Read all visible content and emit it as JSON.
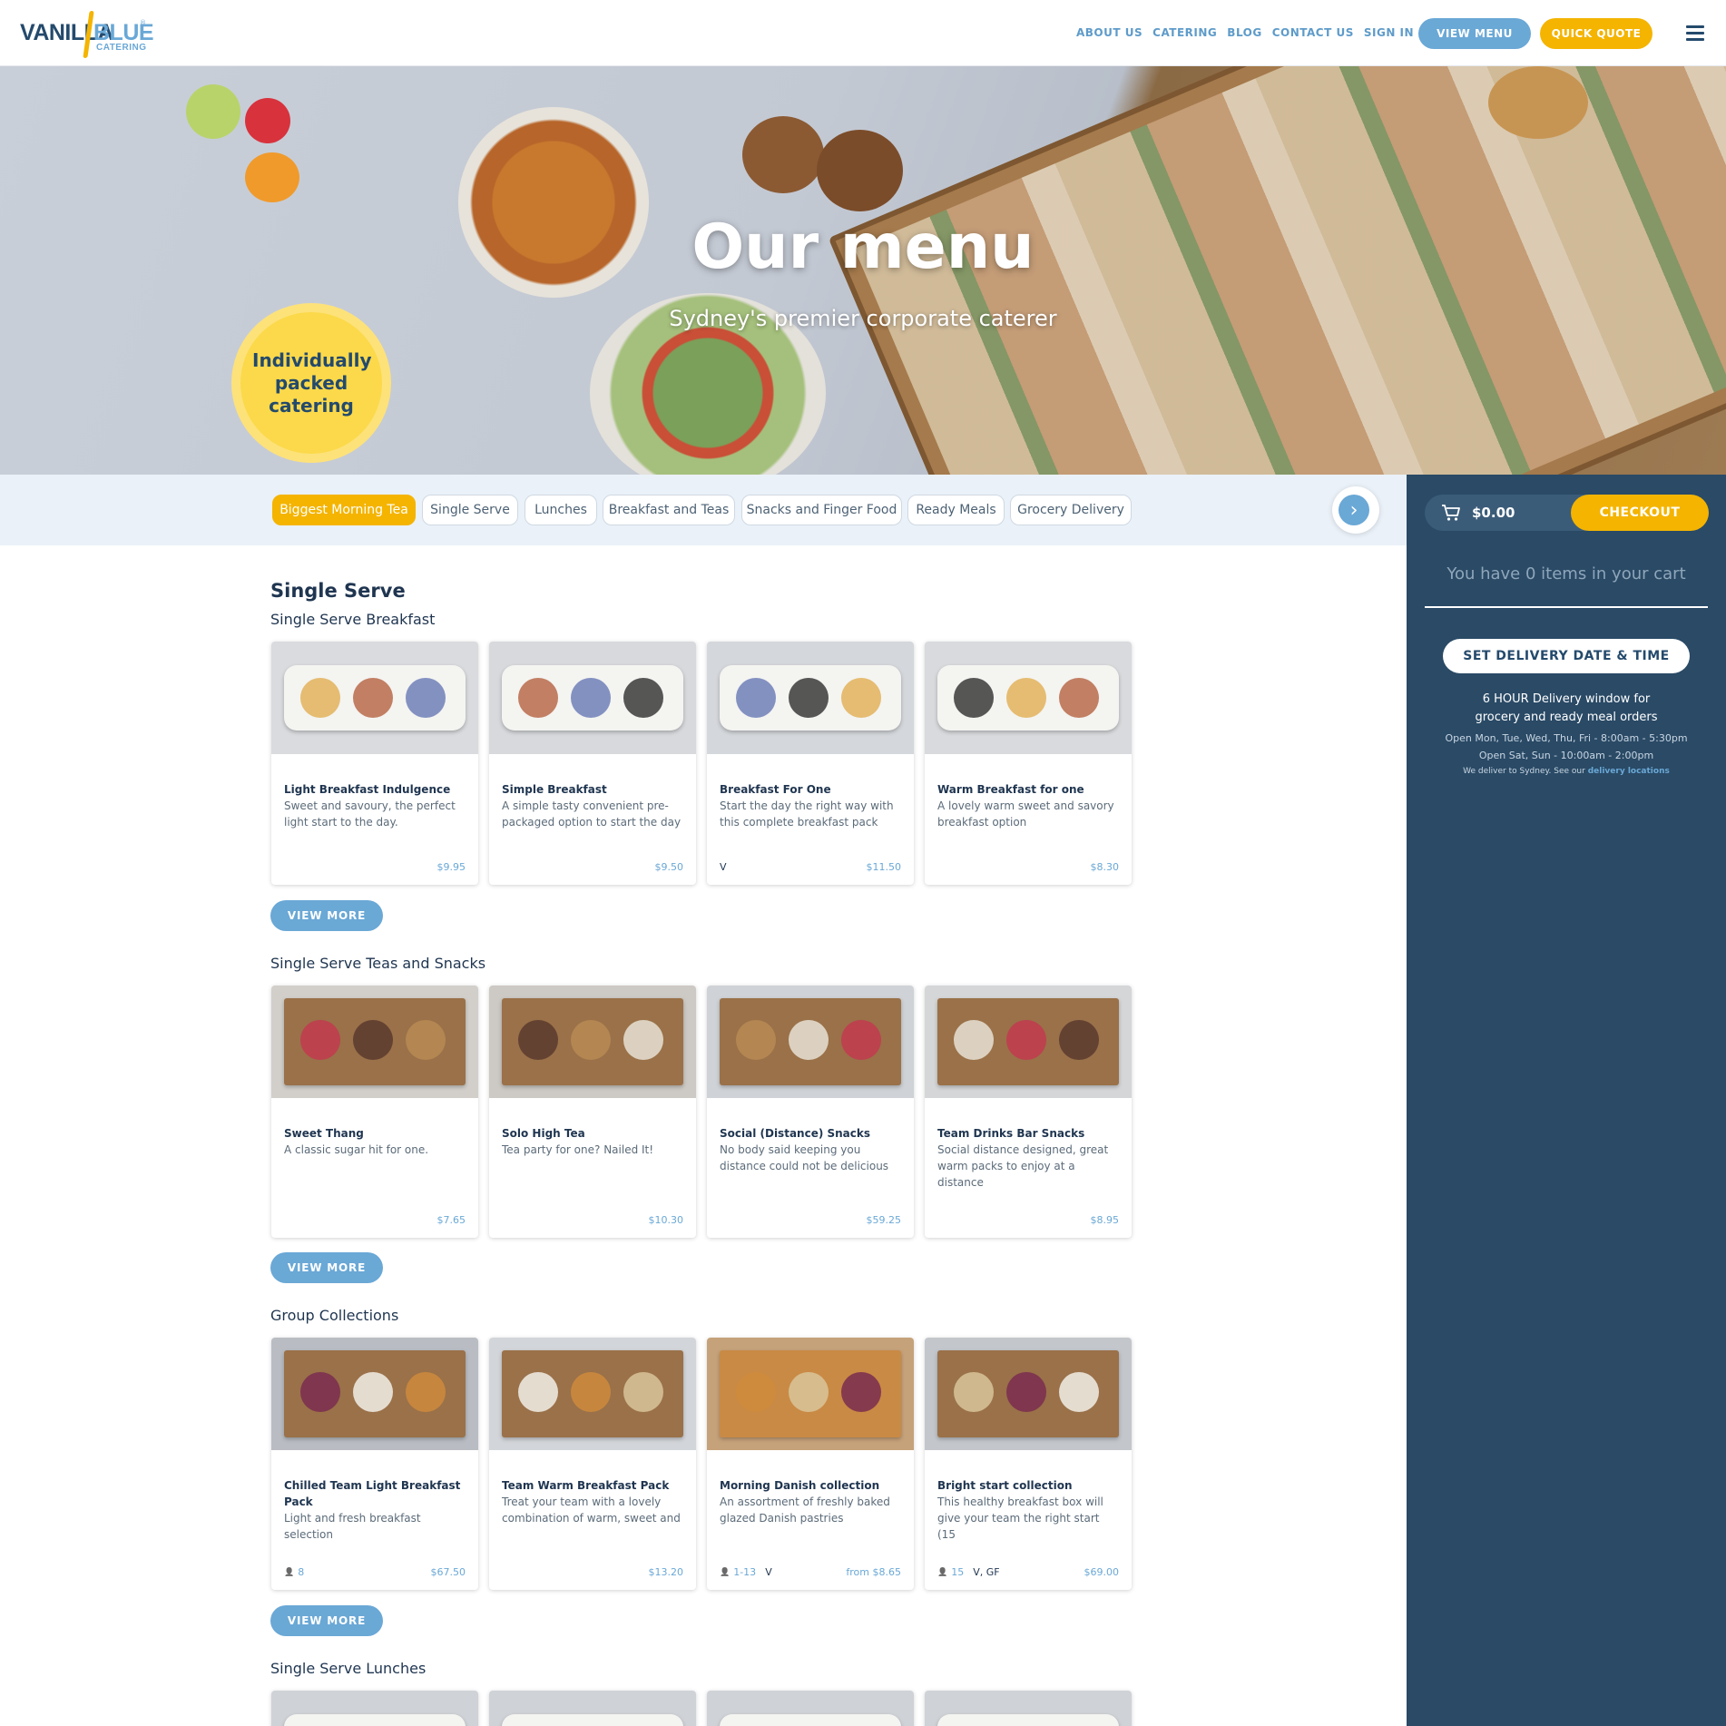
{
  "brand": {
    "word1": "VANILLA",
    "word2": "BLUE",
    "sub": "CATERING",
    "reg": "®"
  },
  "nav": [
    "ABOUT US",
    "CATERING",
    "BLOG",
    "CONTACT US",
    "SIGN IN"
  ],
  "header_buttons": {
    "view_menu": "VIEW MENU",
    "quick_quote": "QUICK QUOTE"
  },
  "hero": {
    "title": "Our menu",
    "subtitle": "Sydney's premier corporate caterer",
    "badge": "Individually packed catering"
  },
  "categories": [
    "Biggest Morning Tea",
    "Single Serve",
    "Lunches",
    "Breakfast and Teas",
    "Snacks and Finger Food",
    "Ready Meals",
    "Grocery Delivery"
  ],
  "active_category": "Biggest Morning Tea",
  "sidebar": {
    "cart_total": "$0.00",
    "checkout": "CHECKOUT",
    "cart_empty": "You have 0 items in your cart",
    "delivery_button": "SET DELIVERY DATE & TIME",
    "delivery_window_1": "6 HOUR Delivery window for",
    "delivery_window_2": "grocery and ready meal orders",
    "hours_1": "Open Mon, Tue, Wed, Thu, Fri - 8:00am - 5:30pm",
    "hours_2": "Open Sat, Sun - 10:00am - 2:00pm",
    "deliver_prefix": "We deliver to Sydney. See our",
    "deliver_link": "delivery locations"
  },
  "main": {
    "section_title": "Single Serve",
    "view_more": "VIEW MORE",
    "groups": [
      {
        "title": "Single Serve Breakfast",
        "cards": [
          {
            "name": "Light Breakfast Indulgence",
            "desc": "Sweet and savoury, the perfect light start to the day.",
            "price": "$9.95",
            "meta": "",
            "diet": ""
          },
          {
            "name": "Simple Breakfast",
            "desc": "A simple tasty convenient pre-packaged option to start the day",
            "price": "$9.50",
            "meta": "",
            "diet": ""
          },
          {
            "name": "Breakfast For One",
            "desc": "Start the day the right way with this complete breakfast pack",
            "price": "$11.50",
            "meta": "",
            "diet": "V"
          },
          {
            "name": "Warm Breakfast for one",
            "desc": "A lovely warm sweet and savory breakfast option",
            "price": "$8.30",
            "meta": "",
            "diet": ""
          }
        ]
      },
      {
        "title": "Single Serve Teas and Snacks",
        "cards": [
          {
            "name": "Sweet Thang",
            "desc": "A classic sugar hit for one.",
            "price": "$7.65",
            "meta": "",
            "diet": ""
          },
          {
            "name": "Solo High Tea",
            "desc": "Tea party for one? Nailed It!",
            "price": "$10.30",
            "meta": "",
            "diet": ""
          },
          {
            "name": "Social (Distance) Snacks",
            "desc": "No body said keeping you distance could not be delicious",
            "price": "$59.25",
            "meta": "",
            "diet": ""
          },
          {
            "name": "Team Drinks Bar Snacks",
            "desc": "Social distance designed, great warm packs to enjoy at a distance",
            "price": "$8.95",
            "meta": "",
            "diet": ""
          }
        ]
      },
      {
        "title": "Group Collections",
        "cards": [
          {
            "name": "Chilled Team Light Breakfast Pack",
            "desc": "Light and fresh breakfast selection",
            "price": "$67.50",
            "meta": "8",
            "diet": ""
          },
          {
            "name": "Team Warm Breakfast Pack",
            "desc": "Treat your team with a lovely combination of warm, sweet and",
            "price": "$13.20",
            "meta": "",
            "diet": ""
          },
          {
            "name": "Morning Danish collection",
            "desc": "An assortment of freshly baked glazed Danish pastries",
            "price": "from $8.65",
            "meta": "1-13",
            "diet": "V"
          },
          {
            "name": "Bright start collection",
            "desc": "This healthy breakfast box will give your team the right start (15",
            "price": "$69.00",
            "meta": "15",
            "diet": "V, GF"
          }
        ]
      },
      {
        "title": "Single Serve Lunches",
        "cards": []
      }
    ]
  },
  "colors": {
    "navy": "#2a4a66",
    "blue": "#6aa8d6",
    "gold": "#f4b400",
    "text": "#1f3550"
  }
}
